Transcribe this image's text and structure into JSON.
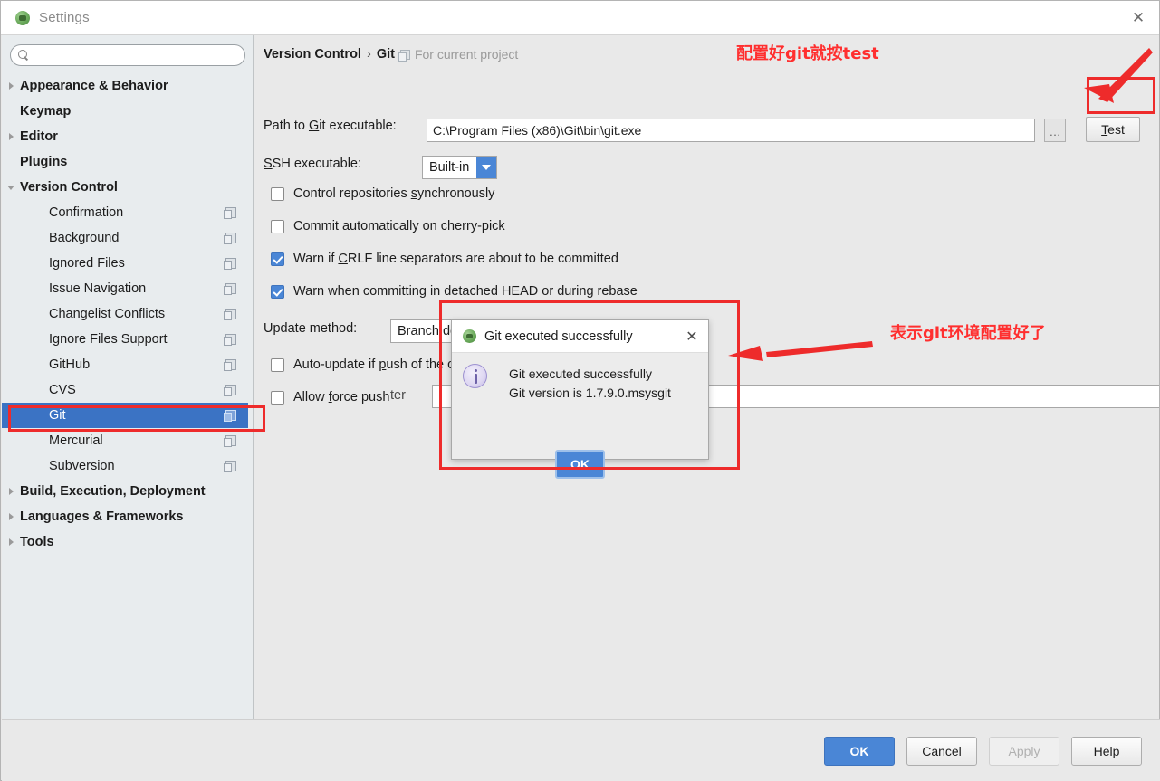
{
  "window": {
    "title": "Settings",
    "icon": "intellij-logo-icon",
    "close_label": "✕"
  },
  "sidebar": {
    "search_placeholder": "",
    "search_value": "",
    "items": [
      {
        "label": "Appearance & Behavior",
        "level": 0,
        "bold": true,
        "arrow": "right",
        "project": false
      },
      {
        "label": "Keymap",
        "level": 0,
        "bold": true,
        "arrow": "none",
        "project": false
      },
      {
        "label": "Editor",
        "level": 0,
        "bold": true,
        "arrow": "right",
        "project": false
      },
      {
        "label": "Plugins",
        "level": 0,
        "bold": true,
        "arrow": "none",
        "project": false
      },
      {
        "label": "Version Control",
        "level": 0,
        "bold": true,
        "arrow": "down",
        "project": false
      },
      {
        "label": "Confirmation",
        "level": 2,
        "bold": false,
        "arrow": "none",
        "project": true
      },
      {
        "label": "Background",
        "level": 2,
        "bold": false,
        "arrow": "none",
        "project": true
      },
      {
        "label": "Ignored Files",
        "level": 2,
        "bold": false,
        "arrow": "none",
        "project": true
      },
      {
        "label": "Issue Navigation",
        "level": 2,
        "bold": false,
        "arrow": "none",
        "project": true
      },
      {
        "label": "Changelist Conflicts",
        "level": 2,
        "bold": false,
        "arrow": "none",
        "project": true
      },
      {
        "label": "Ignore Files Support",
        "level": 2,
        "bold": false,
        "arrow": "none",
        "project": true
      },
      {
        "label": "GitHub",
        "level": 2,
        "bold": false,
        "arrow": "none",
        "project": true
      },
      {
        "label": "CVS",
        "level": 2,
        "bold": false,
        "arrow": "none",
        "project": true
      },
      {
        "label": "Git",
        "level": 2,
        "bold": false,
        "arrow": "none",
        "project": true,
        "selected": true
      },
      {
        "label": "Mercurial",
        "level": 2,
        "bold": false,
        "arrow": "none",
        "project": true
      },
      {
        "label": "Subversion",
        "level": 2,
        "bold": false,
        "arrow": "none",
        "project": true
      },
      {
        "label": "Build, Execution, Deployment",
        "level": 0,
        "bold": true,
        "arrow": "right",
        "project": false
      },
      {
        "label": "Languages & Frameworks",
        "level": 0,
        "bold": true,
        "arrow": "right",
        "project": false
      },
      {
        "label": "Tools",
        "level": 0,
        "bold": true,
        "arrow": "right",
        "project": false
      }
    ]
  },
  "main": {
    "breadcrumb": {
      "parent": "Version Control",
      "separator": "›",
      "current": "Git",
      "scope": "For current project",
      "scope_icon": "project-scope-icon"
    },
    "path_row": {
      "label_pre": "Path to ",
      "label_mnemonic": "G",
      "label_post": "it executable:",
      "value": "C:\\Program Files (x86)\\Git\\bin\\git.exe",
      "browse_label": "…",
      "test_label_mnemonic": "T",
      "test_label_rest": "est"
    },
    "ssh_row": {
      "label_mnemonic": "S",
      "label_rest": "SH executable:",
      "value": "Built-in"
    },
    "checkboxes": [
      {
        "label_pre": "Control repositories ",
        "mnemonic": "s",
        "label_post": "ynchronously",
        "checked": false
      },
      {
        "label_pre": "Commit automatically on cherry-pick",
        "mnemonic": "",
        "label_post": "",
        "checked": false
      },
      {
        "label_pre": "Warn if ",
        "mnemonic": "C",
        "label_post": "RLF line separators are about to be committed",
        "checked": true
      },
      {
        "label_pre": "Warn when committing in detached HEAD or during rebase",
        "mnemonic": "",
        "label_post": "",
        "checked": true
      }
    ],
    "update_method": {
      "label": "Update method:",
      "value": "Branch default"
    },
    "checkboxes2": [
      {
        "label_pre": "Auto-update if ",
        "mnemonic": "p",
        "label_post": "ush of the current branch was rejected",
        "checked": false
      },
      {
        "label_pre": "Allow ",
        "mnemonic": "f",
        "label_post": "orce push",
        "checked": false
      }
    ],
    "protected": {
      "label_tail": "ter",
      "value": "",
      "button_icon": "expand-editor-icon"
    }
  },
  "popup": {
    "title": "Git executed successfully",
    "icon": "intellij-logo-icon",
    "close_label": "✕",
    "info_icon": "info-icon",
    "message_line1": "Git executed successfully",
    "message_line2": "Git version is 1.7.9.0.msysgit",
    "ok_label": "OK"
  },
  "footer": {
    "ok": "OK",
    "cancel": "Cancel",
    "apply": "Apply",
    "help": "Help"
  },
  "annotations": {
    "note_top": "配置好 git 就按 test",
    "note_top_raw": "配置好git就按test",
    "note_right": "表示git环境配置好了",
    "color": "#ee2b2b"
  }
}
